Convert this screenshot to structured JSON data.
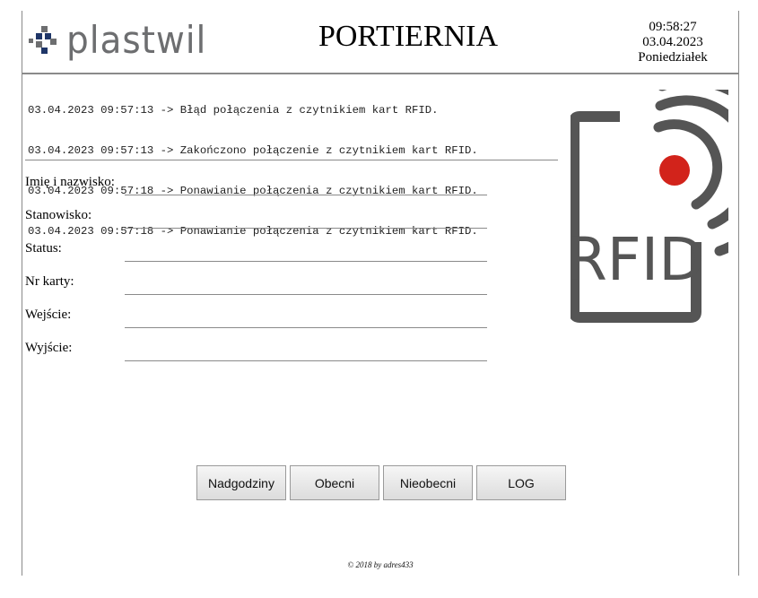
{
  "header": {
    "logo_text": "plastwil",
    "title": "PORTIERNIA",
    "time": "09:58:27",
    "date": "03.04.2023",
    "weekday": "Poniedziałek"
  },
  "log": [
    "03.04.2023 09:57:13 -> Błąd połączenia z czytnikiem kart RFID.",
    "03.04.2023 09:57:13 -> Zakończono połączenie z czytnikiem kart RFID.",
    "03.04.2023 09:57:18 -> Ponawianie połączenia z czytnikiem kart RFID.",
    "03.04.2023 09:57:18 -> Ponawianie połączenia z czytnikiem kart RFID."
  ],
  "form": {
    "fields": [
      {
        "label": "Imię i nazwisko:",
        "value": ""
      },
      {
        "label": "Stanowisko:",
        "value": ""
      },
      {
        "label": "Status:",
        "value": ""
      },
      {
        "label": "Nr karty:",
        "value": ""
      },
      {
        "label": "Wejście:",
        "value": ""
      },
      {
        "label": "Wyjście:",
        "value": ""
      }
    ]
  },
  "rfid_image": {
    "label": "RFID",
    "colors": {
      "body": "#555555",
      "dot": "#d2231b"
    }
  },
  "buttons": {
    "overtime": "Nadgodziny",
    "present": "Obecni",
    "absent": "Nieobecni",
    "log": "LOG"
  },
  "footer": {
    "text": "© 2018 by adres433"
  },
  "colors": {
    "logo_gray": "#6d6e70",
    "logo_navy": "#1f3668",
    "divider": "#8a8a8a"
  }
}
